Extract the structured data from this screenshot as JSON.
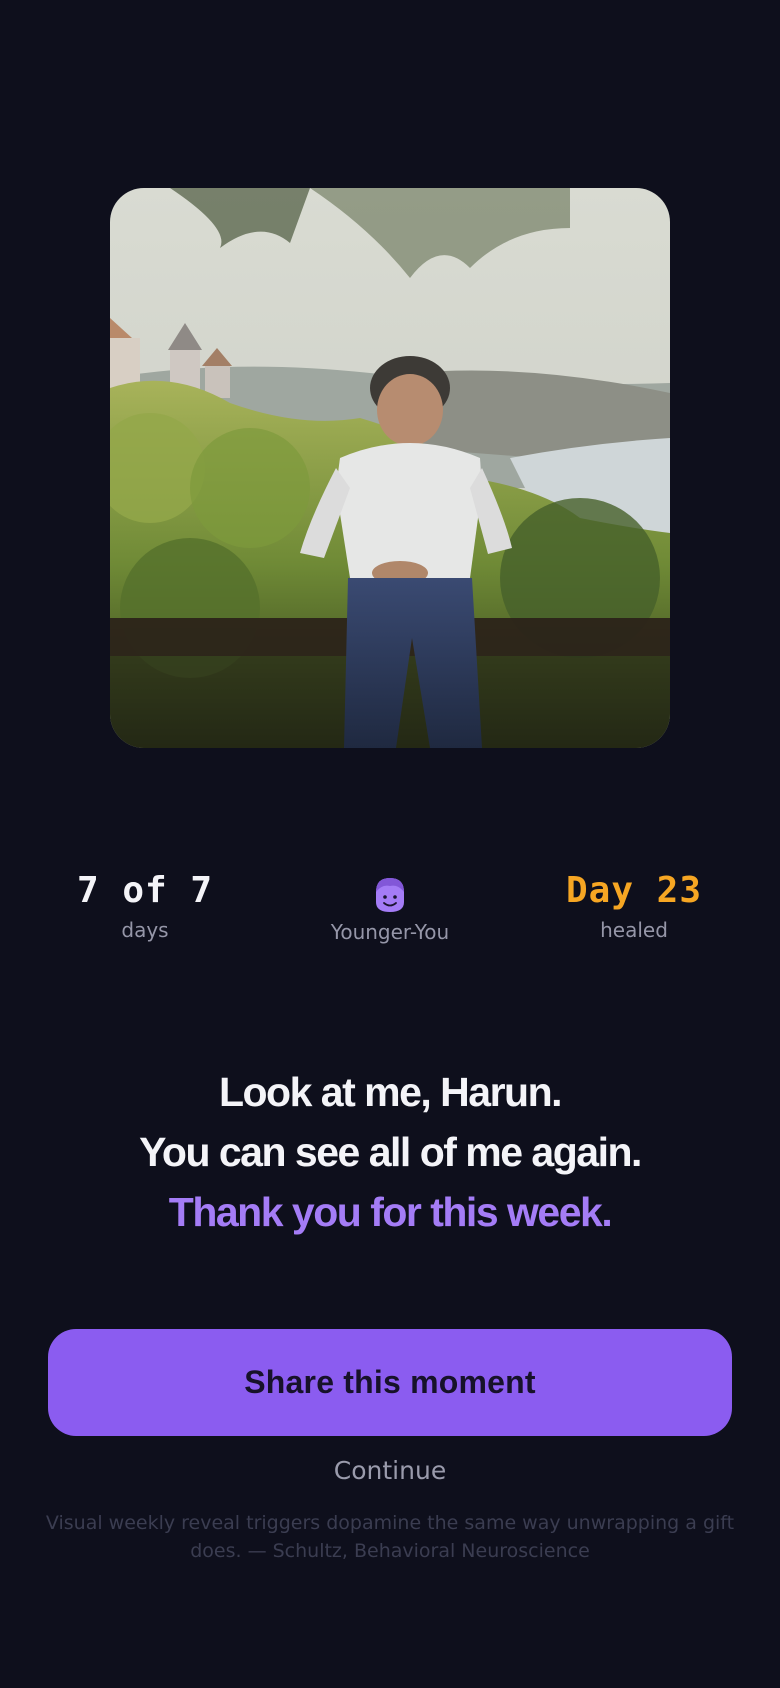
{
  "photo": {
    "alt": "Childhood photo"
  },
  "stats": {
    "progress": {
      "value": "7 of 7",
      "label": "days"
    },
    "persona": {
      "icon": "younger-you-face-icon",
      "label": "Younger-You"
    },
    "streak": {
      "value": "Day 23",
      "label": "healed",
      "color": "#f6a623"
    }
  },
  "message": {
    "line1": "Look at me, Harun.",
    "line2": "You can see all of me again.",
    "line3": "Thank you for this week.",
    "accent_color": "#a47cf6"
  },
  "actions": {
    "share_label": "Share this moment",
    "continue_label": "Continue"
  },
  "footnote": "Visual weekly reveal triggers dopamine the same way unwrapping a gift does. — Schultz, Behavioral Neuroscience",
  "colors": {
    "background": "#0e0f1c",
    "primary": "#8b5cf0"
  }
}
